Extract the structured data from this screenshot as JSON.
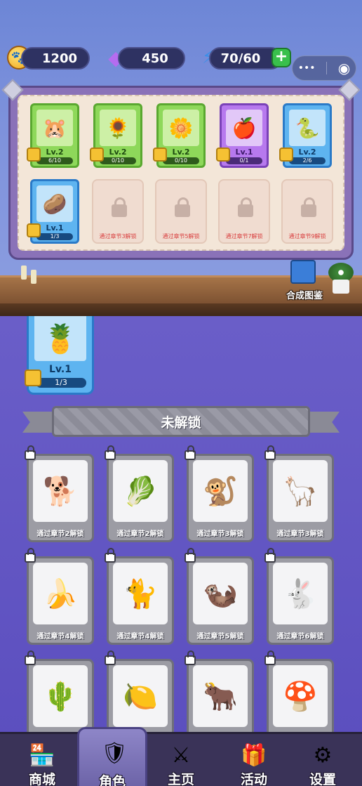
{
  "hud": {
    "coins": "1200",
    "gems": "450",
    "energy": "70/60",
    "add_label": "+",
    "menu_dots": "•••",
    "record_icon": "◉"
  },
  "collection": {
    "cards": [
      {
        "name": "hamster",
        "glyph": "🐹",
        "level": "Lv.2",
        "progress": "6/10",
        "tier": "green"
      },
      {
        "name": "sunflower",
        "glyph": "🌻",
        "level": "Lv.2",
        "progress": "0/10",
        "tier": "green"
      },
      {
        "name": "daisy",
        "glyph": "🌼",
        "level": "Lv.2",
        "progress": "0/10",
        "tier": "green"
      },
      {
        "name": "apple",
        "glyph": "🍎",
        "level": "Lv.1",
        "progress": "0/1",
        "tier": "purple"
      },
      {
        "name": "snake",
        "glyph": "🐍",
        "level": "Lv.2",
        "progress": "2/6",
        "tier": "blue"
      },
      {
        "name": "potato",
        "glyph": "🥔",
        "level": "Lv.1",
        "progress": "1/3",
        "tier": "blue"
      }
    ],
    "locked_slots": [
      "通过章节3解锁",
      "通过章节5解锁",
      "通过章节7解锁",
      "通过章节9解锁"
    ],
    "atlas_label": "合成图鉴"
  },
  "featured": {
    "glyph": "🍍",
    "level": "Lv.1",
    "progress": "1/3"
  },
  "banner": {
    "title": "未解锁"
  },
  "locked_characters": [
    {
      "glyph": "🐕",
      "text": "通过章节2解锁"
    },
    {
      "glyph": "🥬",
      "text": "通过章节2解锁"
    },
    {
      "glyph": "🐒",
      "text": "通过章节3解锁"
    },
    {
      "glyph": "🦙",
      "text": "通过章节3解锁"
    },
    {
      "glyph": "🍌",
      "text": "通过章节4解锁"
    },
    {
      "glyph": "🐈",
      "text": "通过章节4解锁"
    },
    {
      "glyph": "🦦",
      "text": "通过章节5解锁"
    },
    {
      "glyph": "🐇",
      "text": "通过章节6解锁"
    },
    {
      "glyph": "🌵",
      "text": ""
    },
    {
      "glyph": "🍋",
      "text": ""
    },
    {
      "glyph": "🐂",
      "text": ""
    },
    {
      "glyph": "🍄",
      "text": ""
    }
  ],
  "nav": [
    {
      "label": "商城",
      "icon": "shop-icon",
      "glyph": "🏪"
    },
    {
      "label": "角色",
      "icon": "character-icon",
      "glyph": "🛡"
    },
    {
      "label": "主页",
      "icon": "battle-icon",
      "glyph": "⚔"
    },
    {
      "label": "活动",
      "icon": "gift-icon",
      "glyph": "🎁"
    },
    {
      "label": "设置",
      "icon": "settings-icon",
      "glyph": "⚙"
    }
  ]
}
